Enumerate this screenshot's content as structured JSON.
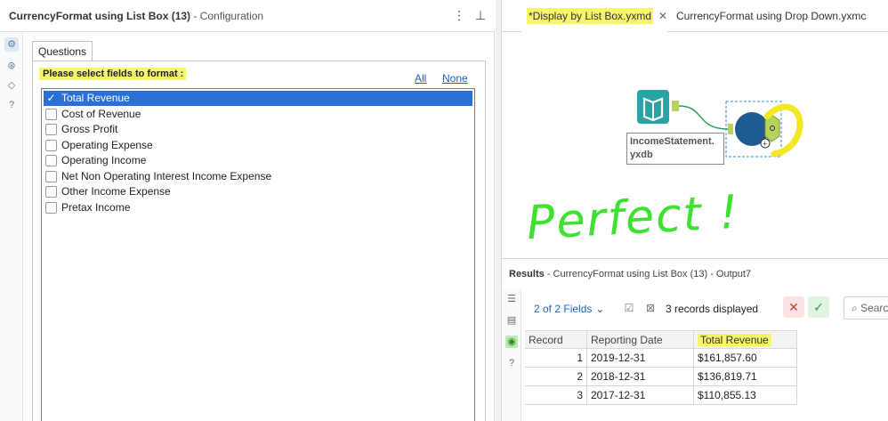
{
  "config": {
    "title_bold": "CurrencyFormat using List Box (13)",
    "title_sub": "- Configuration",
    "menu_icon": "⋮",
    "pin_icon": "⊥",
    "close_icon": "✕",
    "tab_label": "Questions",
    "prompt": "Please select fields to format :",
    "link_all": "All",
    "link_none": "None",
    "fields": [
      {
        "label": "Total Revenue",
        "checked": true
      },
      {
        "label": "Cost of Revenue",
        "checked": false
      },
      {
        "label": "Gross Profit",
        "checked": false
      },
      {
        "label": "Operating Expense",
        "checked": false
      },
      {
        "label": "Operating Income",
        "checked": false
      },
      {
        "label": "Net Non Operating Interest Income Expense",
        "checked": false
      },
      {
        "label": "Other Income Expense",
        "checked": false
      },
      {
        "label": "Pretax Income",
        "checked": false
      }
    ]
  },
  "tabs": [
    {
      "label": "*Display by List Box.yxmd",
      "active": true
    },
    {
      "label": "CurrencyFormat using Drop Down.yxmc",
      "active": false
    }
  ],
  "canvas": {
    "input_tool_label": "IncomeStatement.\nyxdb",
    "annotation": "Perfect !"
  },
  "results": {
    "title_bold": "Results",
    "title_sub": "- CurrencyFormat using List Box (13) - Output7",
    "fields_label": "2 of 2 Fields",
    "records_label": "3 records displayed",
    "search_placeholder": "Search",
    "columns": [
      "Record",
      "Reporting Date",
      "Total Revenue"
    ],
    "rows": [
      [
        "1",
        "2019-12-31",
        "$161,857.60"
      ],
      [
        "2",
        "2018-12-31",
        "$136,819.71"
      ],
      [
        "3",
        "2017-12-31",
        "$110,855.13"
      ]
    ]
  },
  "colors": {
    "highlight": "#f7f56a",
    "selection": "#2a6fd6",
    "link": "#1b64c2",
    "annotation": "#3de22f"
  }
}
